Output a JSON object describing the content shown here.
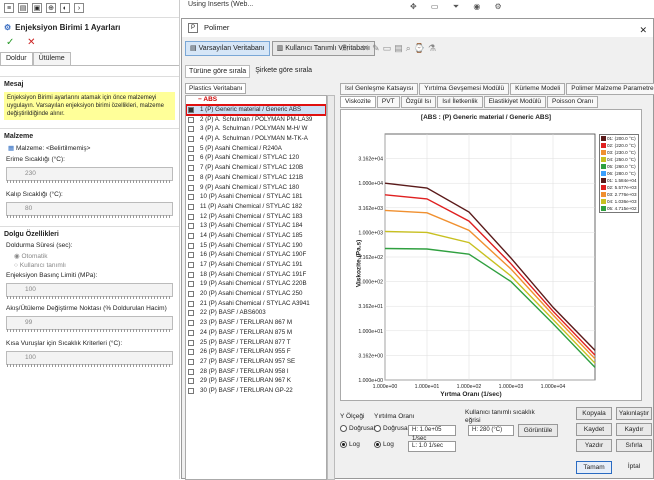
{
  "background": {
    "tab_label": "Using Inserts (Web...",
    "tool_icons": [
      "move-icon",
      "ruler-icon",
      "filter-icon",
      "eye-icon",
      "gear-icon"
    ]
  },
  "left_panel": {
    "title": "Enjeksiyon Birimi 1 Ayarları",
    "ok_glyph": "✓",
    "cancel_glyph": "✕",
    "tabs": [
      "Doldur",
      "Ütüleme"
    ],
    "message_section": "Mesaj",
    "message_text": "Enjeksiyon Birimi ayarlarını atamak için önce malzemeyi uygulayın. Varsayılan enjeksiyon birimi özellikleri, malzeme değiştirildiğinde alınır.",
    "material_section": "Malzeme",
    "material_label": "Malzeme:",
    "material_value": "<Belirtilmemiş>",
    "melt_temp_label": "Erime Sıcaklığı (°C):",
    "melt_temp_value": "230",
    "mold_temp_label": "Kalıp Sıcaklığı (°C):",
    "mold_temp_value": "80",
    "fill_section": "Dolgu Özellikleri",
    "fill_time_label": "Doldurma Süresi (sec):",
    "auto_label": "Otomatik",
    "user_defined_label": "Kullanıcı tanımlı",
    "pressure_limit_label": "Enjeksiyon Basınç Limiti (MPa):",
    "pressure_limit_value": "100",
    "switch_point_label": "Akış/Ütüleme Değiştirme Noktası (% Doldurulan Hacim)",
    "switch_point_value": "99",
    "short_shot_label": "Kısa Vuruşlar için Sıcaklık Kriterleri (°C):",
    "short_shot_value": "100"
  },
  "dialog": {
    "title": "Polimer",
    "toolbar": {
      "default_db": "Varsayılan Veritabanı",
      "user_db": "Kullanıcı Tanımlı Veritabanı"
    },
    "sort_by_label": "Türüne göre sırala",
    "sort_by_company": "Şirkete göre sırala",
    "plastics_db_tab": "Plastics Veritabanı",
    "tree_root": "ABS",
    "materials": [
      "1  (P)  Generic material / Generic ABS",
      "2  (P)  A. Schulman / POLYMAN PM-LA39",
      "3  (P)  A. Schulman / POLYMAN M-H/ W",
      "4  (P)  A. Schulman / POLYMAN M-TK-A",
      "5  (P)  Asahi Chemical / R240A",
      "6  (P)  Asahi Chemical / STYLAC 120",
      "7  (P)  Asahi Chemical / STYLAC 120B",
      "8  (P)  Asahi Chemical / STYLAC 121B",
      "9  (P)  Asahi Chemical / STYLAC 180",
      "10  (P)  Asahi Chemical / STYLAC 181",
      "11  (P)  Asahi Chemical / STYLAC 182",
      "12  (P)  Asahi Chemical / STYLAC 183",
      "13  (P)  Asahi Chemical / STYLAC 184",
      "14  (P)  Asahi Chemical / STYLAC 185",
      "15  (P)  Asahi Chemical / STYLAC 190",
      "16  (P)  Asahi Chemical / STYLAC 190F",
      "17  (P)  Asahi Chemical / STYLAC 191",
      "18  (P)  Asahi Chemical / STYLAC 191F",
      "19  (P)  Asahi Chemical / STYLAC 220B",
      "20  (P)  Asahi Chemical / STYLAC 250",
      "21  (P)  Asahi Chemical / STYLAC A3941",
      "22  (P)  BASF / ABS6003",
      "23  (P)  BASF / TERLURAN 867 M",
      "24  (P)  BASF / TERLURAN 875 M",
      "25  (P)  BASF / TERLURAN 877 T",
      "26  (P)  BASF / TERLURAN 955 F",
      "27  (P)  BASF / TERLURAN 957 SE",
      "28  (P)  BASF / TERLURAN 958 I",
      "29  (P)  BASF / TERLURAN 967 K",
      "30  (P)  BASF / TERLURAN GP-22"
    ],
    "tabs_row1": [
      "Isıl Genleşme Katsayısı",
      "Yırtılma Gevşemesi Modülü",
      "Kürleme Modeli",
      "Polimer Malzeme Parametreleri"
    ],
    "tabs_row2": [
      "Viskozite",
      "PVT",
      "Özgül Isı",
      "Isıl İletkenlik",
      "Elastikiyet Modülü",
      "Poisson Oranı"
    ],
    "bottom": {
      "y_scale_label": "Y Ölçeği",
      "shear_rate_label": "Yırtılma Oranı",
      "linear": "Doğrusal",
      "log": "Log",
      "h_value": "H: 1.0e+05 1/sec",
      "l_value": "L: 1.0 1/sec",
      "user_temp_label": "Kullanıcı tanımlı sıcaklık eğrisi",
      "temp_value": "H: 280 (°C)",
      "view_button": "Görüntüle"
    },
    "buttons": {
      "copy": "Kopyala",
      "compare": "Yakınlaştır",
      "save": "Kaydet",
      "save2": "Kaydır",
      "print": "Yazdır",
      "reset": "Sıfırla",
      "ok": "Tamam",
      "cancel": "İptal"
    }
  },
  "chart_data": {
    "type": "line",
    "title": "[ABS : (P)  Generic material / Generic ABS]",
    "xlabel": "Yırtma Oranı (1/sec)",
    "ylabel": "Viskozite (Pa.s)",
    "x_scale": "log",
    "y_scale": "log",
    "xlim": [
      1,
      100000
    ],
    "ylim": [
      1,
      100000
    ],
    "x_ticks": [
      "1.000e+00",
      "1.000e+01",
      "1.000e+02",
      "1.000e+03",
      "1.000e+04"
    ],
    "y_ticks": [
      "3.162e+04",
      "1.000e+04",
      "3.162e+03",
      "1.000e+03",
      "3.162e+02",
      "1.000e+02",
      "3.162e+01",
      "1.000e+01",
      "3.162e+00",
      "1.000e+00"
    ],
    "legend_position": "top-right",
    "legend": [
      "01: (200.0 °C)",
      "02: (220.0 °C)",
      "03: (230.0 °C)",
      "04: (250.0 °C)",
      "05: (260.0 °C)",
      "06: (280.0 °C)",
      "01: 1.584e+04",
      "02: 5.577e+03",
      "03: 2.776e+03",
      "04: 1.036e+03",
      "05: 4.715e+02"
    ],
    "series": [
      {
        "name": "01: (200.0 °C)",
        "color": "#5a1a1a",
        "values": [
          [
            1,
            10000
          ],
          [
            10,
            8000
          ],
          [
            100,
            2600
          ],
          [
            1000,
            300
          ],
          [
            10000,
            30
          ],
          [
            100000,
            4
          ]
        ]
      },
      {
        "name": "02: (220.0 °C)",
        "color": "#e02020",
        "values": [
          [
            1,
            5800
          ],
          [
            10,
            4800
          ],
          [
            100,
            1700
          ],
          [
            1000,
            230
          ],
          [
            10000,
            25
          ],
          [
            100000,
            3.2
          ]
        ]
      },
      {
        "name": "03: (230.0 °C)",
        "color": "#f09030",
        "values": [
          [
            1,
            2800
          ],
          [
            10,
            2500
          ],
          [
            100,
            1100
          ],
          [
            1000,
            180
          ],
          [
            10000,
            21
          ],
          [
            100000,
            2.7
          ]
        ]
      },
      {
        "name": "04: (250.0 °C)",
        "color": "#c8c020",
        "values": [
          [
            1,
            1050
          ],
          [
            10,
            1000
          ],
          [
            100,
            620
          ],
          [
            1000,
            130
          ],
          [
            10000,
            17
          ],
          [
            100000,
            2.2
          ]
        ]
      },
      {
        "name": "05: (260.0 °C)",
        "color": "#30a040",
        "values": [
          [
            1,
            470
          ],
          [
            10,
            460
          ],
          [
            100,
            360
          ],
          [
            1000,
            100
          ],
          [
            10000,
            14
          ],
          [
            100000,
            1.8
          ]
        ]
      }
    ]
  }
}
